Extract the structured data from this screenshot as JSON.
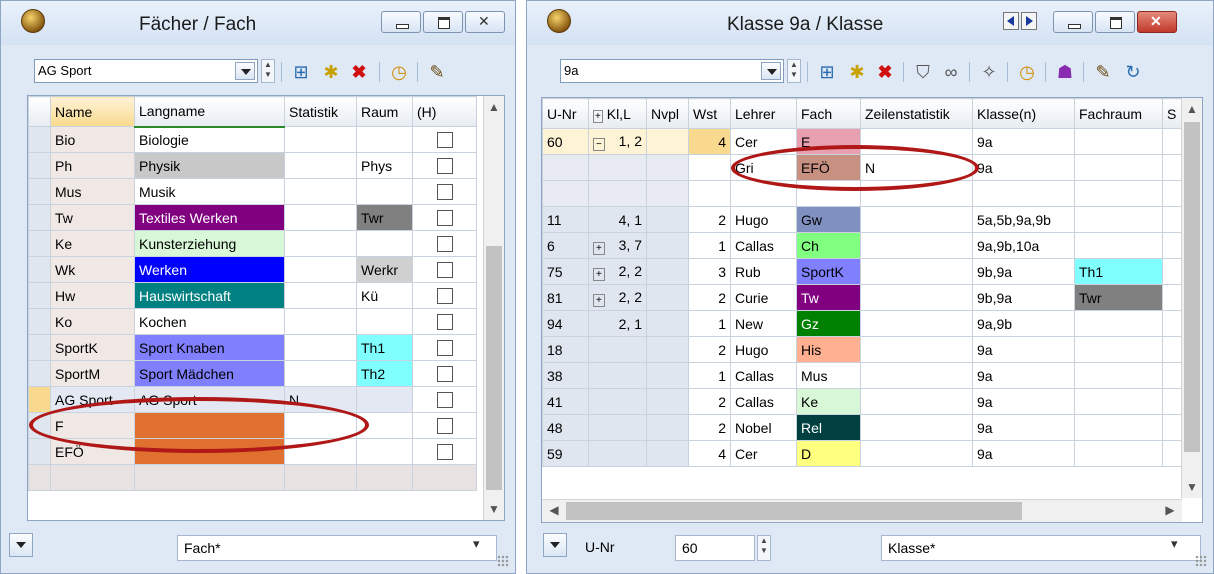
{
  "left_window": {
    "title": "Fächer / Fach",
    "combo_value": "AG Sport",
    "headers": [
      "Name",
      "Langname",
      "Statistik",
      "Raum",
      "(H)"
    ],
    "rows": [
      {
        "name": "Bio",
        "langname": "Biologie",
        "statistik": "",
        "raum": "",
        "lang_bg": "",
        "raum_bg": ""
      },
      {
        "name": "Ph",
        "langname": "Physik",
        "statistik": "",
        "raum": "Phys",
        "lang_bg": "#c8c8c8",
        "raum_bg": ""
      },
      {
        "name": "Mus",
        "langname": "Musik",
        "statistik": "",
        "raum": "",
        "lang_bg": "",
        "raum_bg": ""
      },
      {
        "name": "Tw",
        "langname": "Textiles Werken",
        "statistik": "",
        "raum": "Twr",
        "lang_bg": "#800080",
        "raum_bg": "#808080"
      },
      {
        "name": "Ke",
        "langname": "Kunsterziehung",
        "statistik": "",
        "raum": "",
        "lang_bg": "#d7f7d7",
        "raum_bg": ""
      },
      {
        "name": "Wk",
        "langname": "Werken",
        "statistik": "",
        "raum": "Werkr",
        "lang_bg": "#0000ff",
        "raum_bg": "#d0d0d0"
      },
      {
        "name": "Hw",
        "langname": "Hauswirtschaft",
        "statistik": "",
        "raum": "Kü",
        "lang_bg": "#008080",
        "raum_bg": ""
      },
      {
        "name": "Ko",
        "langname": "Kochen",
        "statistik": "",
        "raum": "",
        "lang_bg": "",
        "raum_bg": ""
      },
      {
        "name": "SportK",
        "langname": "Sport Knaben",
        "statistik": "",
        "raum": "Th1",
        "lang_bg": "#8080ff",
        "raum_bg": "#80ffff"
      },
      {
        "name": "SportM",
        "langname": "Sport Mädchen",
        "statistik": "",
        "raum": "Th2",
        "lang_bg": "#8080ff",
        "raum_bg": "#80ffff"
      },
      {
        "name": "AG Sport",
        "langname": "AG Sport",
        "statistik": "N",
        "raum": "",
        "lang_bg": "",
        "raum_bg": ""
      },
      {
        "name": "F",
        "langname": "",
        "statistik": "",
        "raum": "",
        "lang_bg": "#e07030",
        "raum_bg": ""
      },
      {
        "name": "EFÖ",
        "langname": "",
        "statistik": "",
        "raum": "",
        "lang_bg": "#e07030",
        "raum_bg": ""
      }
    ],
    "status_field": "Fach*"
  },
  "right_window": {
    "title": "Klasse 9a / Klasse",
    "combo_value": "9a",
    "headers": [
      "U-Nr",
      "Kl,L",
      "Nvpl",
      "Wst",
      "Lehrer",
      "Fach",
      "Zeilenstatistik",
      "Klasse(n)",
      "Fachraum",
      "S"
    ],
    "rows": [
      {
        "unr": "60",
        "kll": "1, 2",
        "nvpl": "",
        "wst": "4",
        "lehrer": "Cer",
        "fach": "E",
        "zeilen": "",
        "klassen": "9a",
        "fachraum": "",
        "fach_bg": "#e8a0b0",
        "fachraum_bg": "",
        "plus": "minus"
      },
      {
        "unr": "",
        "kll": "",
        "nvpl": "",
        "wst": "",
        "lehrer": "Gri",
        "fach": "EFÖ",
        "zeilen": "N",
        "klassen": "9a",
        "fachraum": "",
        "fach_bg": "#c89080",
        "fachraum_bg": "",
        "plus": ""
      },
      {
        "unr": "",
        "kll": "",
        "nvpl": "",
        "wst": "",
        "lehrer": "",
        "fach": "",
        "zeilen": "",
        "klassen": "",
        "fachraum": "",
        "fach_bg": "",
        "fachraum_bg": "",
        "plus": ""
      },
      {
        "unr": "11",
        "kll": "4, 1",
        "nvpl": "",
        "wst": "2",
        "lehrer": "Hugo",
        "fach": "Gw",
        "zeilen": "",
        "klassen": "5a,5b,9a,9b",
        "fachraum": "",
        "fach_bg": "#8090c0",
        "fachraum_bg": "",
        "plus": ""
      },
      {
        "unr": "6",
        "kll": "3, 7",
        "nvpl": "",
        "wst": "1",
        "lehrer": "Callas",
        "fach": "Ch",
        "zeilen": "",
        "klassen": "9a,9b,10a",
        "fachraum": "",
        "fach_bg": "#80ff80",
        "fachraum_bg": "",
        "plus": "plus"
      },
      {
        "unr": "75",
        "kll": "2, 2",
        "nvpl": "",
        "wst": "3",
        "lehrer": "Rub",
        "fach": "SportK",
        "zeilen": "",
        "klassen": "9b,9a",
        "fachraum": "Th1",
        "fach_bg": "#8080ff",
        "fachraum_bg": "#80ffff",
        "plus": "plus"
      },
      {
        "unr": "81",
        "kll": "2, 2",
        "nvpl": "",
        "wst": "2",
        "lehrer": "Curie",
        "fach": "Tw",
        "zeilen": "",
        "klassen": "9b,9a",
        "fachraum": "Twr",
        "fach_bg": "#800080",
        "fachraum_bg": "#808080",
        "plus": "plus"
      },
      {
        "unr": "94",
        "kll": "2, 1",
        "nvpl": "",
        "wst": "1",
        "lehrer": "New",
        "fach": "Gz",
        "zeilen": "",
        "klassen": "9a,9b",
        "fachraum": "",
        "fach_bg": "#008000",
        "fachraum_bg": "",
        "plus": ""
      },
      {
        "unr": "18",
        "kll": "",
        "nvpl": "",
        "wst": "2",
        "lehrer": "Hugo",
        "fach": "His",
        "zeilen": "",
        "klassen": "9a",
        "fachraum": "",
        "fach_bg": "#ffb090",
        "fachraum_bg": "",
        "plus": ""
      },
      {
        "unr": "38",
        "kll": "",
        "nvpl": "",
        "wst": "1",
        "lehrer": "Callas",
        "fach": "Mus",
        "zeilen": "",
        "klassen": "9a",
        "fachraum": "",
        "fach_bg": "",
        "fachraum_bg": "",
        "plus": ""
      },
      {
        "unr": "41",
        "kll": "",
        "nvpl": "",
        "wst": "2",
        "lehrer": "Callas",
        "fach": "Ke",
        "zeilen": "",
        "klassen": "9a",
        "fachraum": "",
        "fach_bg": "#d7f7d7",
        "fachraum_bg": "",
        "plus": ""
      },
      {
        "unr": "48",
        "kll": "",
        "nvpl": "",
        "wst": "2",
        "lehrer": "Nobel",
        "fach": "Rel",
        "zeilen": "",
        "klassen": "9a",
        "fachraum": "",
        "fach_bg": "#004040",
        "fachraum_bg": "",
        "plus": ""
      },
      {
        "unr": "59",
        "kll": "",
        "nvpl": "",
        "wst": "4",
        "lehrer": "Cer",
        "fach": "D",
        "zeilen": "",
        "klassen": "9a",
        "fachraum": "",
        "fach_bg": "#ffff80",
        "fachraum_bg": "",
        "plus": ""
      }
    ],
    "status_label": "U-Nr",
    "status_unr": "60",
    "status_field": "Klasse*"
  },
  "colors": {
    "callout": "#b01818",
    "dark_text_bgs": [
      "#800080",
      "#0000ff",
      "#008080",
      "#008000",
      "#004040"
    ]
  }
}
